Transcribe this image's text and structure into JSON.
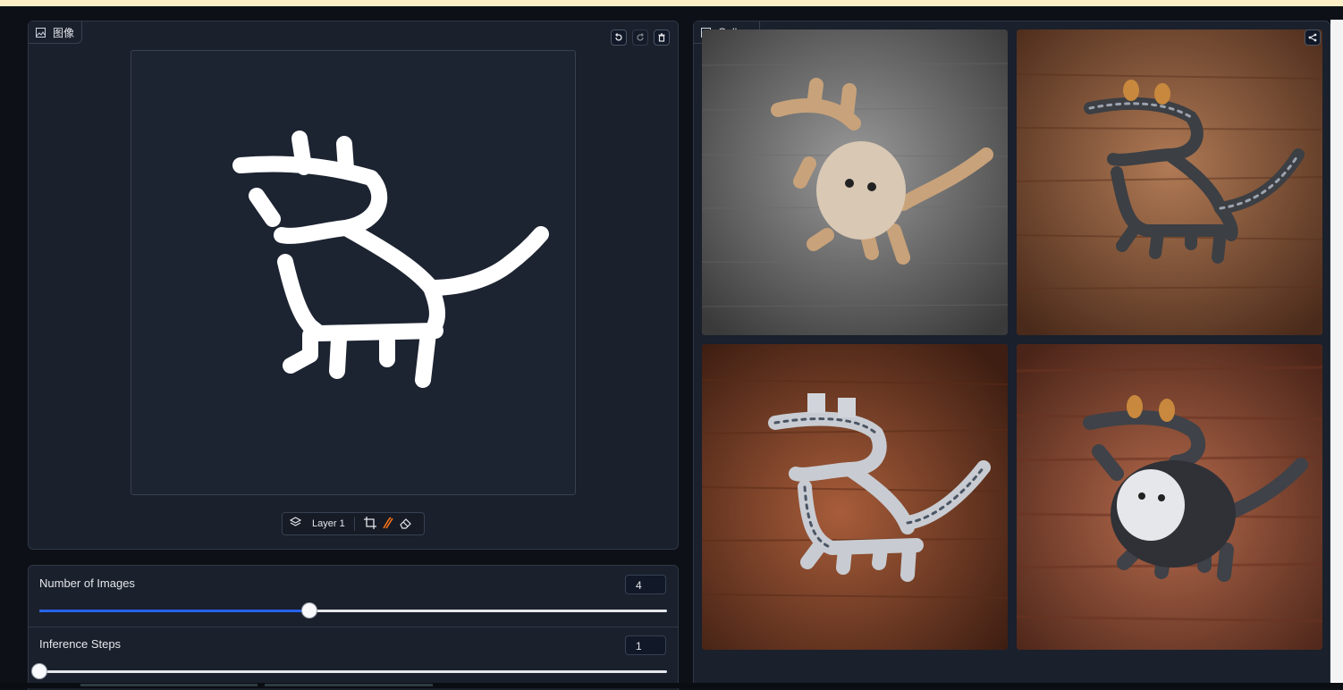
{
  "image_editor": {
    "label": "图像",
    "label_icon": "image-icon",
    "tools": {
      "undo_icon": "undo-icon",
      "redo_icon": "redo-icon",
      "clear_icon": "trash-icon"
    },
    "layer_label": "Layer 1",
    "toolbar_icons": [
      "layers-icon",
      "crop-icon",
      "brush-icon",
      "eraser-icon"
    ]
  },
  "settings": {
    "num_images": {
      "label": "Number of Images",
      "value": "4",
      "fraction": 0.43
    },
    "inference_steps": {
      "label": "Inference Steps",
      "value": "1",
      "fraction": 0.0
    }
  },
  "gallery": {
    "label": "Gallery",
    "label_icon": "image-icon",
    "share_icon": "share-icon",
    "images": [
      {
        "name": "gallery-image-1",
        "background": "#5b5b5b"
      },
      {
        "name": "gallery-image-2",
        "background": "#7a4a2e"
      },
      {
        "name": "gallery-image-3",
        "background": "#7d3f26"
      },
      {
        "name": "gallery-image-4",
        "background": "#8a4a35"
      }
    ]
  },
  "colors": {
    "accent": "#2563eb",
    "panel": "#1a202c",
    "page": "#0d1117"
  }
}
